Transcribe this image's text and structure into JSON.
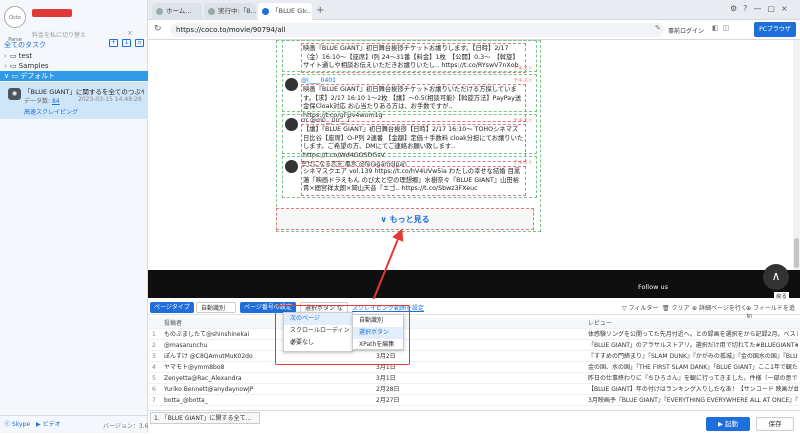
{
  "sidebar": {
    "logo_text": "Octo Parse",
    "user_sub": "料金を私に切り替え",
    "close": "×",
    "tasks_header": "全てのタスク",
    "folders": [
      {
        "label": "test"
      },
      {
        "label": "Samples"
      }
    ],
    "default_folder": "デフォルト",
    "task": {
      "title": "「BLUE GIANT」に関するを全てのつぶやき...",
      "data_label": "データ数:",
      "data_count": "84",
      "date": "2023-03-15 14:48:26",
      "mode": "高速スクレイピング"
    },
    "footer_skype": "Skype",
    "footer_video": "ビデオ",
    "version": "バージョン：3.6.4"
  },
  "browser": {
    "tabs": [
      {
        "label": "ホーム..."
      },
      {
        "label": "実行中:「B..."
      },
      {
        "label": "「BLUE GI..."
      }
    ],
    "new_tab": "+",
    "url": "https://coco.to/movie/90794/all",
    "login": "事前ログイン",
    "pc_browser": "PCブラウザ"
  },
  "feed": {
    "tweets": [
      {
        "handle": "",
        "text": "映画『BLUE GIANT』初日舞台挨拶チケットお譲りします。【日時】2/17（金）16:10〜【座席】I列 24〜31番【料金】1枚　【公開】0.3〜　【斡旋】サイト通しや相談お伝えいただきお譲りいたし‥ https://t.co/RYswV7nXob"
      },
      {
        "handle": "@i____0401",
        "text": "映画『BLUE GIANT』初日舞台挨拶チケットお譲りいただける方探しています。【求】2/17 16:10 1〜2枚 【譲】〜0.5(相談可能)【斡旋方法】PayPay送金保Cloak対応 お心当たりある方は、お手数ですが‥ https://t.co/gFUv4wom1g"
      },
      {
        "handle": "rrr @m0__0rr__7",
        "text": "【譲】『BLUE GIANT』初日舞台挨拶【日時】2/17 16:10〜 TOHOシネマズ日比谷【座席】O-P列 2連番 【金額】定価＋手数料 cloak分担にてお譲りいたします。ご希望の方、DMにてご連絡お願い致します‥ https://t.co/Wd4GOSDGsV"
      },
      {
        "handle": "幸せになる恋を 風水 @feragamoJpan",
        "text": "シネマスクエア vol.139 https://t.co/hV4UVw5ia わたしの幸せな結婚 目黒蓮『映画ドラえもん のび太と空の理想郷』水樹奈々『BLUE GIANT』山田裕貴×間宮祥太朗×岡山天音『エゴ‥ https://t.co/Sbwz3FXeuc"
      }
    ],
    "label_text": "テキスト",
    "more_button": "∨ もっと見る"
  },
  "banner": {
    "follow": "Follow us",
    "back": "戻る",
    "up": "∧"
  },
  "panel": {
    "page_type_label": "ページタイプ",
    "page_type_value": "自動識別",
    "page_flip_label": "ページ番号の設定",
    "select_value": "選択ボタン など",
    "scroll_settings": "スクレイピング範囲を設定",
    "filter": "フィルター",
    "clear": "クリア",
    "preview": "詳細ページを行く",
    "add_field": "フィールドを追加",
    "menu1": [
      "次のページ",
      "スクロールローディング",
      "必要なし"
    ],
    "menu2": [
      "自動識別",
      "選択ボタン",
      "XPathを編集"
    ],
    "columns": [
      "投稿者",
      "",
      "レビュー"
    ],
    "rows": [
      {
        "n": "1",
        "author": "ものぶましたて@shinshinekai",
        "date": "",
        "review": "体感験ソングを公開ってた先月付近へ。との録画を選択をから記録2月。ベスト10は「BL"
      },
      {
        "n": "2",
        "author": "@masarunchu",
        "date": "",
        "review": "「BLUE GIANT」のアラサルストアリ。選択だけ用で切れてた#BLUEGIANT#ブルージャイ"
      },
      {
        "n": "3",
        "author": "ぽんすけ @C8QAmutMuK02do",
        "date": "3月2日",
        "review": "『すすめの門締まり』『SLAM DUNK』『かがみの孤城』『金の国水の国』『BLUE GIANT』"
      },
      {
        "n": "4",
        "author": "ヤマモト@ymm8bo8",
        "date": "3月1日",
        "review": "金の国、水の国」「THE FIRST SLAM DANK」「BLUE GIANT」ここ1年で観たアニメ映画"
      },
      {
        "n": "5",
        "author": "Zenyetta@Rac_Alexandra",
        "date": "3月1日",
        "review": "昨日の仕事終わりに『ちひろさん』を観に行ってきました。件様（一部の意で住なく、殿"
      },
      {
        "n": "6",
        "author": "Yuriko Bennett@anydaynowJP",
        "date": "2月28日",
        "review": "【BLUE GIANT】年の付けはランキング入りしたなあ！【サンコード 映画が並んだ高者】"
      },
      {
        "n": "7",
        "author": "botta_@botta_",
        "date": "2月27日",
        "review": "3月映画予『BLUE GIANT』『EVERYTHING EVERYWHERE ALL AT ONCE』『シン・仮面"
      }
    ]
  },
  "footer": {
    "task_tab": "1. 「BLUE GIANT」に関する全て...",
    "start": "▶ 起動",
    "save": "保存"
  },
  "colors": {
    "accent": "#1e6fd9",
    "highlight": "#e53935",
    "selected_task": "#cfe5f8"
  }
}
